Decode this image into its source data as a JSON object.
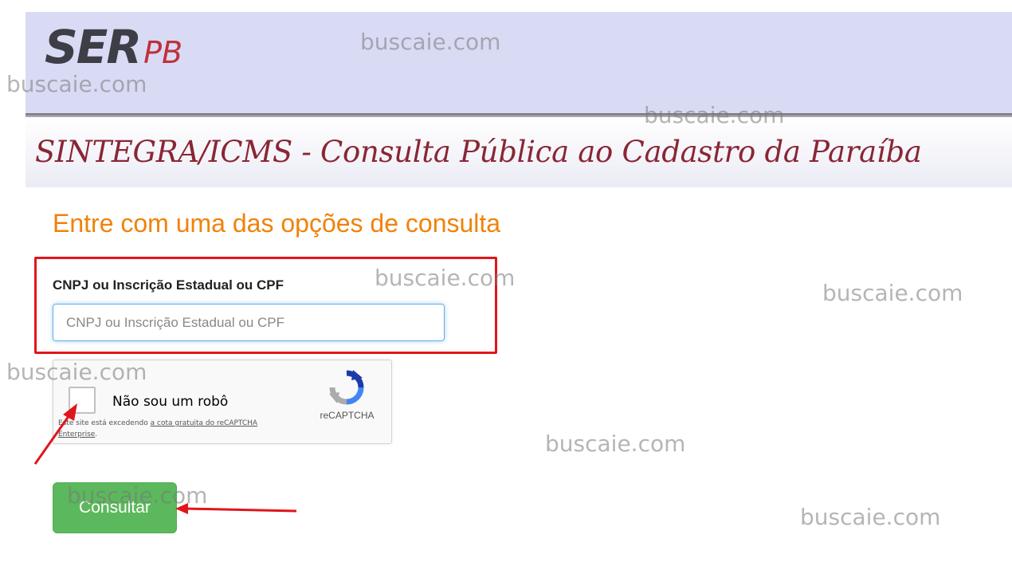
{
  "header": {
    "logo_main": "SER",
    "logo_sub": "PB",
    "title": "SINTEGRA/ICMS - Consulta Pública ao Cadastro da Paraíba"
  },
  "form": {
    "heading": "Entre com uma das opções de consulta",
    "field_label": "CNPJ ou Inscrição Estadual ou CPF",
    "field_placeholder": "CNPJ ou Inscrição Estadual ou CPF",
    "field_value": ""
  },
  "recaptcha": {
    "checkbox_label": "Não sou um robô",
    "brand": "reCAPTCHA",
    "quota_prefix": "Este site está excedendo ",
    "quota_link": "a cota gratuita do reCAPTCHA Enterprise",
    "quota_suffix": "."
  },
  "actions": {
    "submit_label": "Consultar"
  },
  "watermark": {
    "text": "buscaie.com"
  },
  "colors": {
    "header_bg": "#d9dbf5",
    "title_color": "#8a2634",
    "heading_color": "#f0820a",
    "highlight_color": "#e0161b",
    "button_color": "#5cb85c"
  }
}
